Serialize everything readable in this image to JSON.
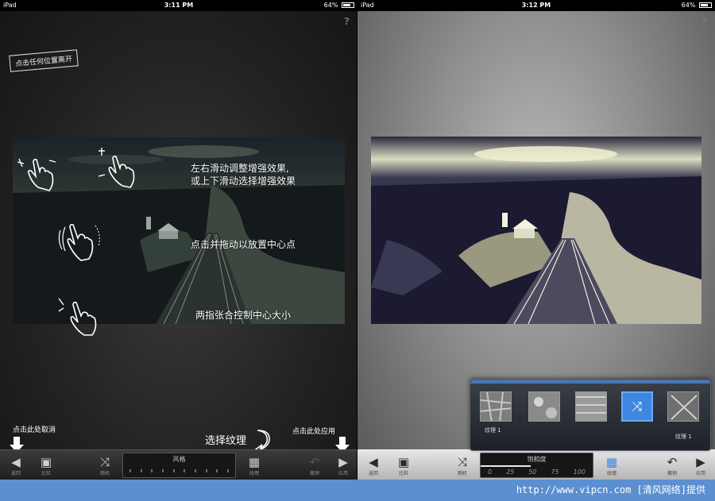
{
  "left": {
    "status": {
      "carrier": "iPad",
      "time": "3:11 PM",
      "battery": "64%"
    },
    "help_label": "?",
    "tap_anywhere_label": "点击任何位置离开",
    "tips": {
      "swipe": "左右滑动调整增强效果,\n或上下滑动选择增强效果",
      "drag": "点击并拖动以放置中心点",
      "pinch": "两指张合控制中心大小"
    },
    "cancel_hint": "点击此处取消",
    "texture_hint": "选择纹理",
    "apply_hint": "点击此处应用",
    "toolbar": {
      "back_label": "返回",
      "compare_label": "比较",
      "random_label": "随机",
      "slider_label": "风格",
      "texture_label": "纹理",
      "reset_label": "撤销",
      "apply_label": "应用"
    }
  },
  "right": {
    "status": {
      "carrier": "iPad",
      "time": "3:12 PM",
      "battery": "64%"
    },
    "help_label": "?",
    "texture_items": [
      {
        "label": "纹理 1"
      },
      {
        "label": ""
      },
      {
        "label": ""
      },
      {
        "label": ""
      },
      {
        "label": "纹理 1"
      }
    ],
    "toolbar": {
      "back_label": "返回",
      "compare_label": "比较",
      "random_label": "随机",
      "slider_label": "饱和度",
      "slider_numbers": [
        "0",
        "25",
        "50",
        "75",
        "100"
      ],
      "slider_value": 0.45,
      "texture_label": "纹理",
      "reset_label": "撤销",
      "apply_label": "应用"
    }
  },
  "footer": {
    "watermark": "http://www.vipcn.com [清风网络]提供"
  },
  "colors": {
    "footer_bg": "#5b8fd0",
    "selected_texture": "#3f86e0"
  },
  "icons": {
    "back": "triangle-left-icon",
    "compare": "image-icon",
    "random": "shuffle-icon",
    "texture": "checker-icon",
    "reset": "undo-icon",
    "apply": "triangle-right-icon"
  }
}
